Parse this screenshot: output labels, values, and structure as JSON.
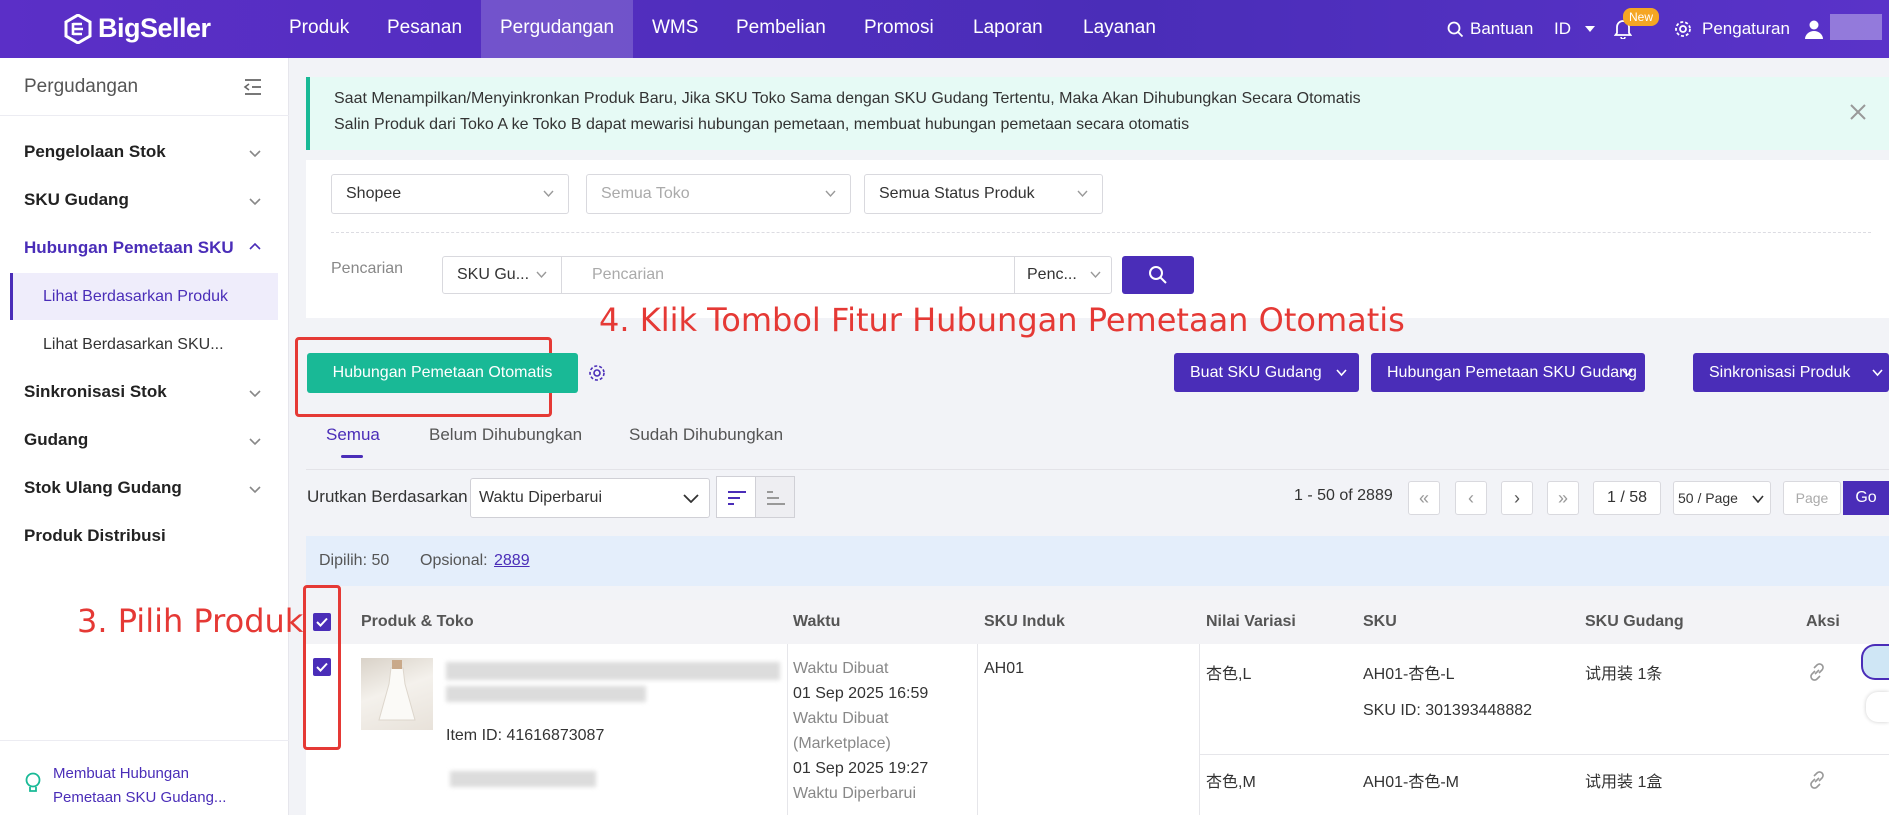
{
  "brand": {
    "name": "BigSeller"
  },
  "nav": {
    "items": [
      "Produk",
      "Pesanan",
      "Pergudangan",
      "WMS",
      "Pembelian",
      "Promosi",
      "Laporan",
      "Layanan"
    ],
    "active": "Pergudangan"
  },
  "topright": {
    "help": "Bantuan",
    "lang": "ID",
    "new_badge": "New",
    "settings": "Pengaturan"
  },
  "sidebar": {
    "title": "Pergudangan",
    "items": [
      {
        "label": "Pengelolaan Stok"
      },
      {
        "label": "SKU Gudang"
      },
      {
        "label": "Hubungan Pemetaan SKU"
      },
      {
        "label": "Sinkronisasi Stok"
      },
      {
        "label": "Gudang"
      },
      {
        "label": "Stok Ulang Gudang"
      },
      {
        "label": "Produk Distribusi"
      }
    ],
    "subitems": [
      "Lihat Berdasarkan Produk",
      "Lihat Berdasarkan SKU..."
    ],
    "tip": "Membuat Hubungan Pemetaan SKU Gudang..."
  },
  "notice": {
    "line1": "Saat Menampilkan/Menyinkronkan Produk Baru, Jika SKU Toko Sama dengan SKU Gudang Tertentu, Maka Akan Dihubungkan Secara Otomatis",
    "line2": "Salin Produk dari Toko A ke Toko B dapat mewarisi hubungan pemetaan, membuat hubungan pemetaan secara otomatis"
  },
  "filters": {
    "marketplace": "Shopee",
    "store": "Semua Toko",
    "status": "Semua Status Produk",
    "search_label": "Pencarian",
    "search_type": "SKU Gu...",
    "search_placeholder": "Pencarian",
    "search_mode": "Penc..."
  },
  "actions": {
    "auto_map": "Hubungan Pemetaan Otomatis",
    "create_sku": "Buat SKU Gudang",
    "map_sku": "Hubungan Pemetaan SKU Gudang",
    "sync": "Sinkronisasi Produk"
  },
  "annotations": {
    "step3": "3. Pilih Produk",
    "step4": "4. Klik Tombol Fitur Hubungan Pemetaan Otomatis"
  },
  "tabs": [
    "Semua",
    "Belum Dihubungkan",
    "Sudah Dihubungkan"
  ],
  "sort": {
    "label": "Urutkan Berdasarkan",
    "value": "Waktu Diperbarui"
  },
  "pagination": {
    "range": "1 - 50 of 2889",
    "page": "1 / 58",
    "per_page": "50 / Page",
    "page_placeholder": "Page",
    "go": "Go"
  },
  "selection": {
    "selected_label": "Dipilih: 50",
    "optional_label": "Opsional:",
    "optional_count": "2889"
  },
  "table": {
    "headers": [
      "Produk & Toko",
      "Waktu",
      "SKU Induk",
      "Nilai Variasi",
      "SKU",
      "SKU Gudang",
      "Aksi"
    ],
    "row": {
      "item_id": "Item ID: 41616873087",
      "time": [
        "Waktu Dibuat",
        "01 Sep 2025 16:59",
        "Waktu Dibuat",
        "(Marketplace)",
        "01 Sep 2025 19:27",
        "Waktu Diperbarui"
      ],
      "parent_sku": "AH01",
      "variants": [
        {
          "value": "杏色,L",
          "sku": "AH01-杏色-L",
          "sku_id": "SKU ID: 301393448882",
          "warehouse_sku": "试用装 1条"
        },
        {
          "value": "杏色,M",
          "sku": "AH01-杏色-M",
          "warehouse_sku": "试用装 1盒"
        }
      ]
    }
  }
}
